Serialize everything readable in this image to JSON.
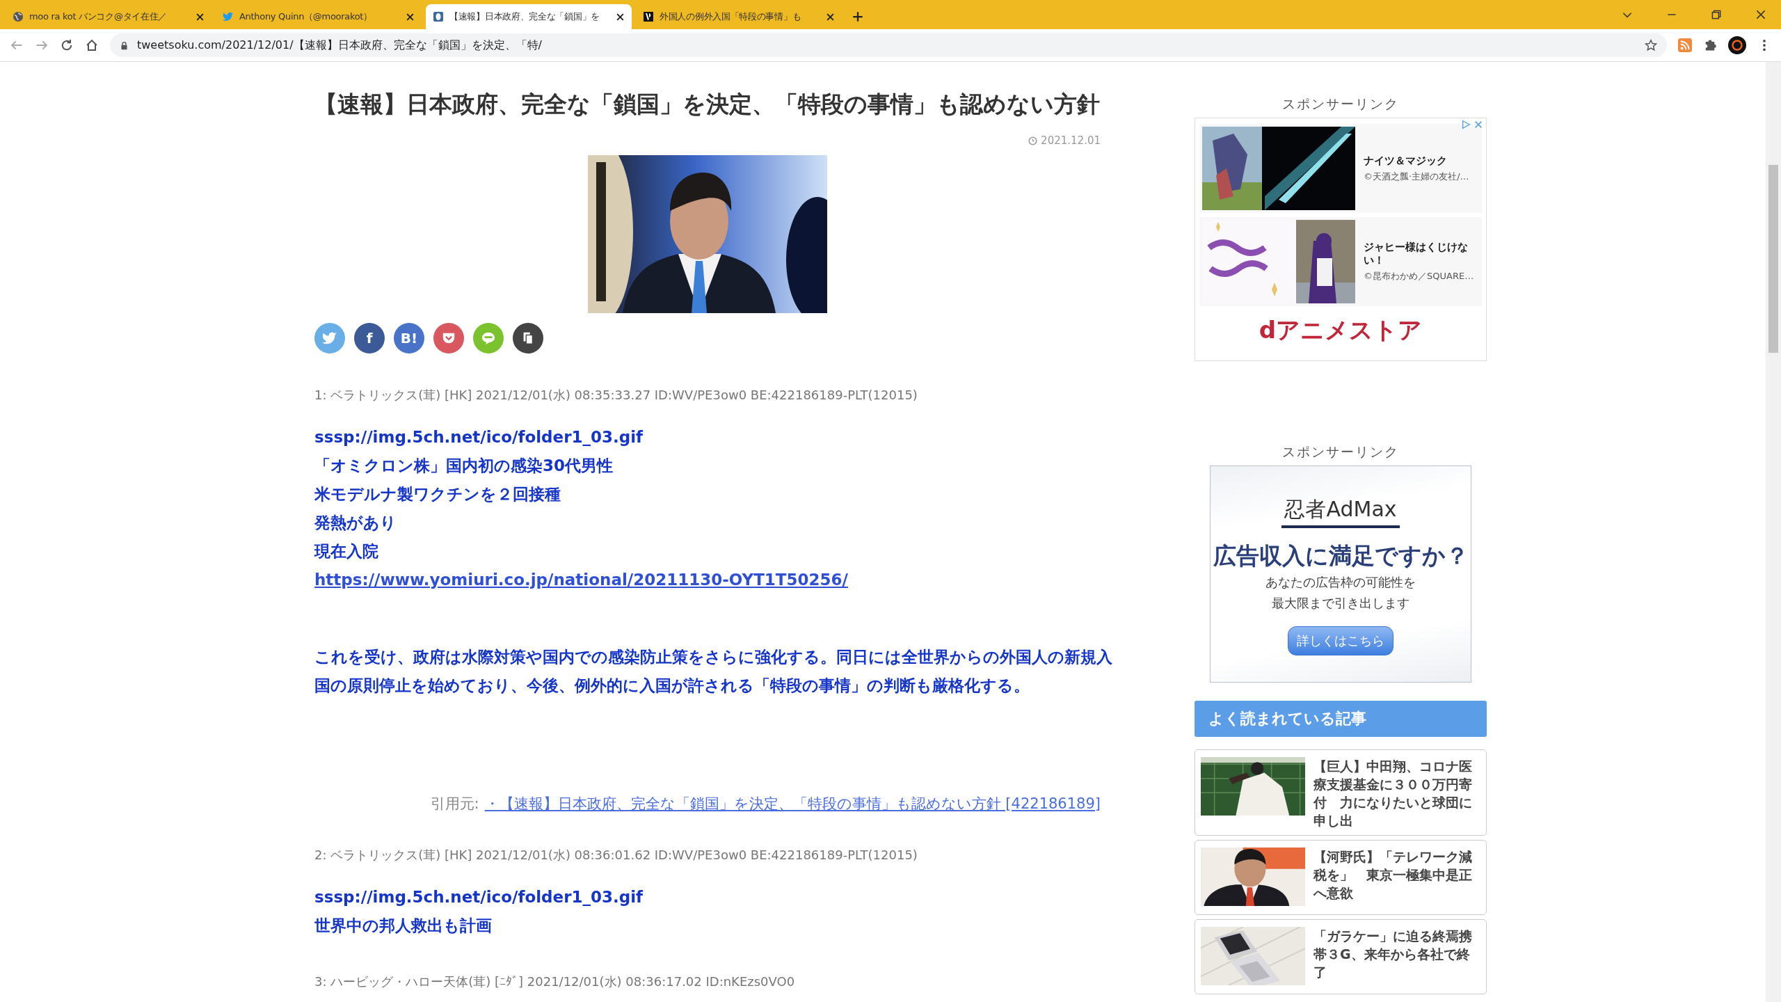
{
  "browser": {
    "tabs": [
      {
        "title": "moo ra kot バンコク@タイ在住／",
        "selected": false
      },
      {
        "title": "Anthony Quinn（@moorakot）",
        "selected": false
      },
      {
        "title": "【速報】日本政府、完全な「鎖国」を",
        "selected": true
      },
      {
        "title": "外国人の例外入国「特段の事情」も",
        "selected": false
      }
    ],
    "address": "tweetsoku.com/2021/12/01/【速報】日本政府、完全な「鎖国」を決定、「特/"
  },
  "article": {
    "title": "【速報】日本政府、完全な「鎖国」を決定、「特段の事情」も認めない方針",
    "date": "2021.12.01",
    "share_buttons": [
      {
        "kind": "twitter"
      },
      {
        "kind": "facebook",
        "label": "f"
      },
      {
        "kind": "hatena",
        "label": "B!"
      },
      {
        "kind": "pocket"
      },
      {
        "kind": "line"
      },
      {
        "kind": "copy"
      }
    ],
    "posts": [
      {
        "meta": "1: ベラトリックス(茸) [HK] 2021/12/01(水) 08:35:33.27 ID:WV/PE3ow0 BE:422186189-PLT(12015)",
        "blocks": [
          {
            "kind": "line",
            "text": "sssp://img.5ch.net/ico/folder1_03.gif"
          },
          {
            "kind": "line",
            "text": "「オミクロン株」国内初の感染30代男性"
          },
          {
            "kind": "line",
            "text": "米モデルナ製ワクチンを２回接種"
          },
          {
            "kind": "line",
            "text": "発熱があり"
          },
          {
            "kind": "line",
            "text": "現在入院"
          },
          {
            "kind": "url",
            "text": "https://www.yomiuri.co.jp/national/20211130-OYT1T50256/"
          },
          {
            "kind": "paragraph",
            "text": "これを受け、政府は水際対策や国内での感染防止策をさらに強化する。同日には全世界からの外国人の新規入国の原則停止を始めており、今後、例外的に入国が許される「特段の事情」の判断も厳格化する。"
          },
          {
            "kind": "citation",
            "label": "引用元:",
            "text": "・【速報】日本政府、完全な「鎖国」を決定、「特段の事情」も認めない方針 [422186189]"
          }
        ]
      },
      {
        "meta": "2: ベラトリックス(茸) [HK] 2021/12/01(水) 08:36:01.62 ID:WV/PE3ow0 BE:422186189-PLT(12015)",
        "blocks": [
          {
            "kind": "line",
            "text": "sssp://img.5ch.net/ico/folder1_03.gif"
          },
          {
            "kind": "line",
            "text": "世界中の邦人救出も計画"
          }
        ]
      },
      {
        "meta": "3: ハービッグ・ハロー天体(茸) [ﾆﾀﾞ] 2021/12/01(水) 08:36:17.02 ID:nKEzs0VO0"
      }
    ]
  },
  "sidebar": {
    "ad_top": {
      "label": "スポンサーリンク",
      "items": [
        {
          "title": "ナイツ＆マジック",
          "credit": "©天酒之瓢·主婦の友社/…"
        },
        {
          "title": "ジャヒー様はくじけない！",
          "credit": "©昆布わかめ／SQUARE…"
        }
      ],
      "brand": "dアニメストア"
    },
    "ad_bottom": {
      "label": "スポンサーリンク",
      "logo": "忍者AdMax",
      "headline": "広告収入に満足ですか？",
      "body": [
        "あなたの広告枠の可能性を",
        "最大限まで引き出します"
      ],
      "button": "詳しくはこちら"
    },
    "popular": {
      "heading": "よく読まれている記事",
      "items": [
        {
          "title": "【巨人】中田翔、コロナ医療支援基金に３００万円寄付　力になりたいと球団に申し出"
        },
        {
          "title": "【河野氏】「テレワーク減税を」　東京一極集中是正へ意欲"
        },
        {
          "title": "「ガラケー」に迫る終焉携帯３G、来年から各社で終了"
        }
      ]
    }
  }
}
